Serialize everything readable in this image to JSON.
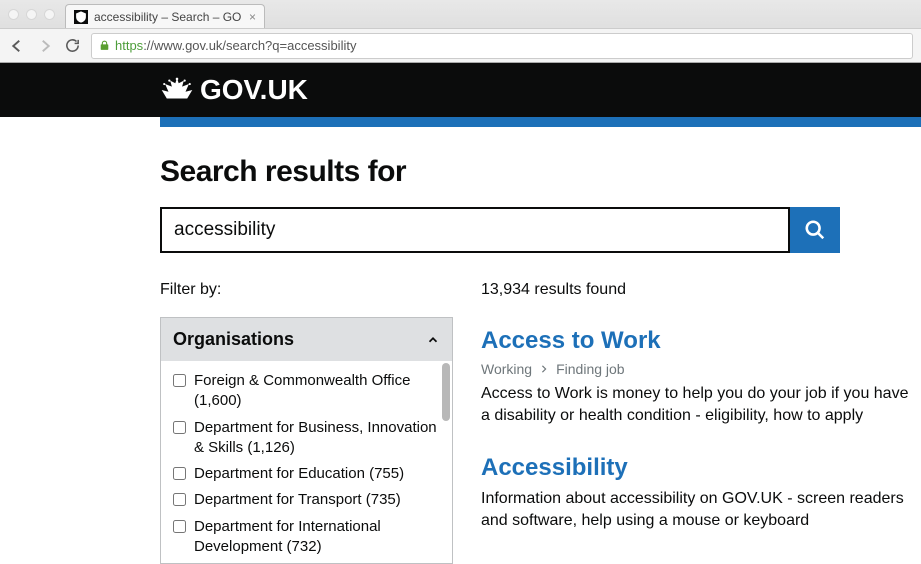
{
  "browser": {
    "tab_title": "accessibility – Search – GO",
    "url_proto": "https",
    "url_rest": "://www.gov.uk/search?q=accessibility"
  },
  "header": {
    "wordmark": "GOV.UK"
  },
  "search": {
    "heading": "Search results for",
    "value": "accessibility"
  },
  "filter": {
    "label": "Filter by:",
    "panel_title": "Organisations",
    "orgs": [
      {
        "label": "Foreign & Commonwealth Office (1,600)"
      },
      {
        "label": "Department for Business, Innovation & Skills (1,126)"
      },
      {
        "label": "Department for Education (755)"
      },
      {
        "label": "Department for Transport (735)"
      },
      {
        "label": "Department for International Development (732)"
      }
    ]
  },
  "results": {
    "count_text": "13,934 results found",
    "items": [
      {
        "title": "Access to Work",
        "breadcrumb": [
          "Working",
          "Finding job"
        ],
        "desc": "Access to Work is money to help you do your job if you have a disability or health condition - eligibility, how to apply"
      },
      {
        "title": "Accessibility",
        "breadcrumb": [],
        "desc": "Information about accessibility on GOV.UK - screen readers and software, help using a mouse or keyboard"
      }
    ]
  }
}
